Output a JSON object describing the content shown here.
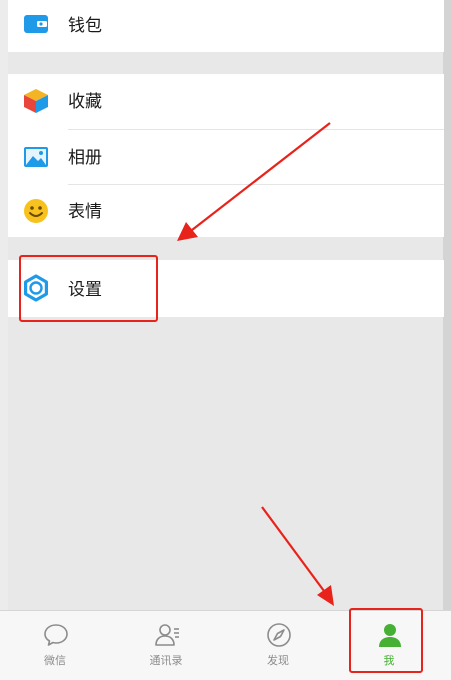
{
  "wallet": {
    "label": "钱包",
    "icon": "wallet-icon"
  },
  "group2": {
    "items": [
      {
        "label": "收藏",
        "icon": "favorites-cube-icon"
      },
      {
        "label": "相册",
        "icon": "album-image-icon"
      },
      {
        "label": "表情",
        "icon": "sticker-smiley-icon"
      }
    ]
  },
  "settings": {
    "label": "设置",
    "icon": "settings-gear-icon"
  },
  "tabbar": {
    "tabs": [
      {
        "label": "微信",
        "icon": "chat-bubble-icon"
      },
      {
        "label": "通讯录",
        "icon": "contacts-icon"
      },
      {
        "label": "发现",
        "icon": "compass-icon"
      },
      {
        "label": "我",
        "icon": "me-person-icon",
        "active": true
      }
    ]
  },
  "colors": {
    "accent_green": "#46b035",
    "icon_blue": "#1f9ae8",
    "annotation_red": "#e8231b",
    "background": "#e8e8e8"
  }
}
